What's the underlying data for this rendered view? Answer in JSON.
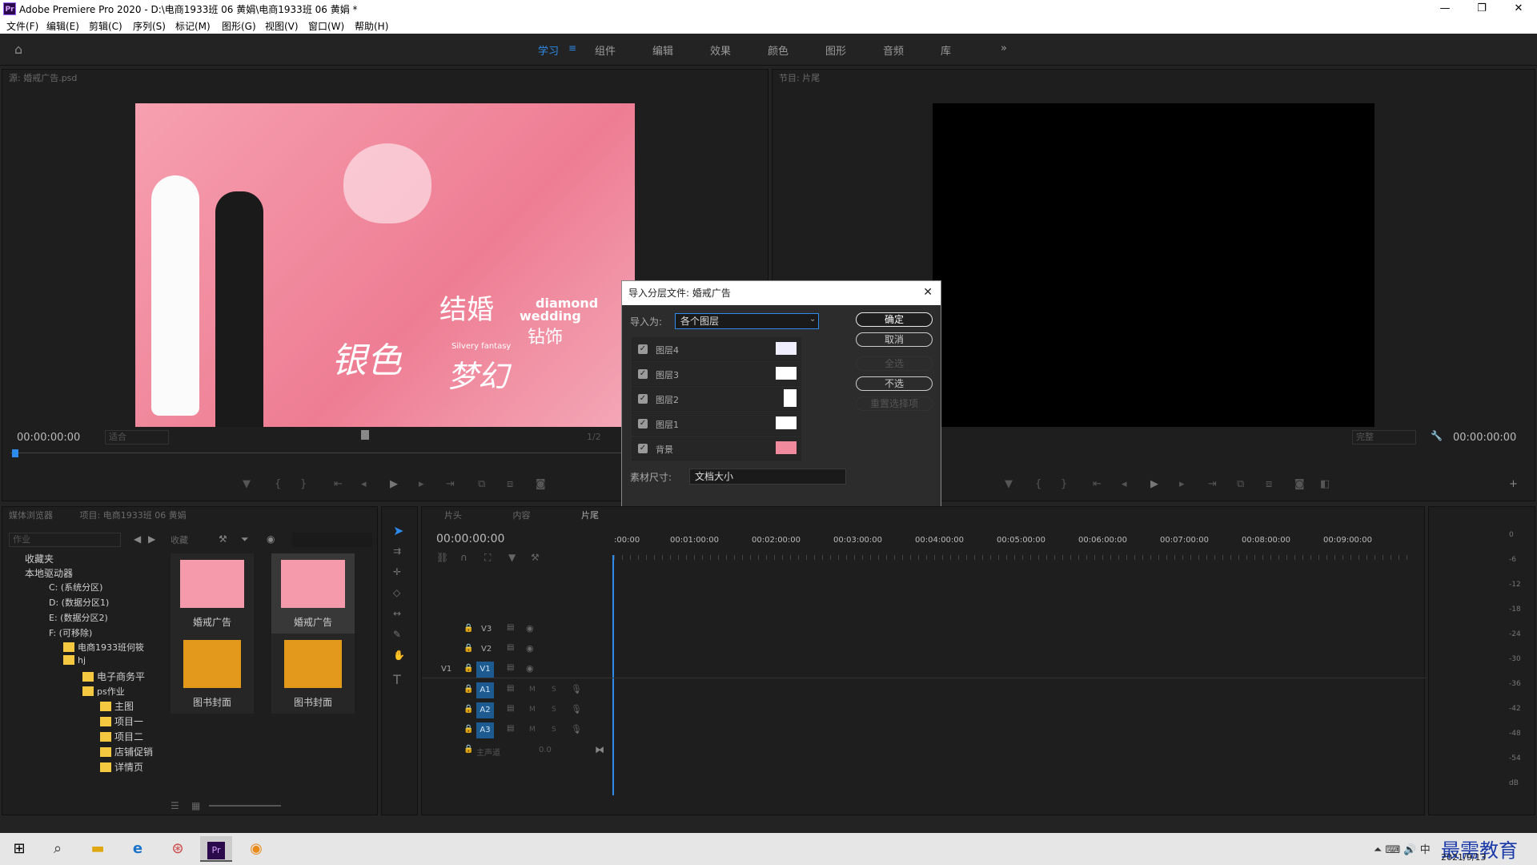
{
  "window": {
    "title": "Adobe Premiere Pro 2020 - D:\\电商1933班 06 黄娟\\电商1933班 06 黄娟 *",
    "logo": "Pr"
  },
  "menu": [
    "文件(F)",
    "编辑(E)",
    "剪辑(C)",
    "序列(S)",
    "标记(M)",
    "图形(G)",
    "视图(V)",
    "窗口(W)",
    "帮助(H)"
  ],
  "workspaces": {
    "items": [
      "学习",
      "组件",
      "编辑",
      "效果",
      "颜色",
      "图形",
      "音频",
      "库"
    ],
    "active": "学习",
    "more": "»"
  },
  "source": {
    "title": "源: 婚戒广告.psd",
    "timecode": "00:00:00:00",
    "fit": "适合",
    "page": "1/2",
    "poster": {
      "t1": "结婚",
      "t2": "diamond",
      "t3": "wedding",
      "t4": "钻饰",
      "t5": "Silvery fantasy",
      "t6": "银色",
      "t7": "梦幻"
    }
  },
  "program": {
    "title": "节目: 片尾",
    "timecode": "00:00:00:00",
    "quality": "完整"
  },
  "dialog": {
    "title": "导入分层文件: 婚戒广告",
    "import_as_label": "导入为:",
    "import_as_value": "各个图层",
    "buttons": {
      "ok": "确定",
      "cancel": "取消",
      "select_all": "全选",
      "select_none": "不选",
      "reset": "重置选择项"
    },
    "layers": [
      {
        "name": "图层4",
        "checked": true
      },
      {
        "name": "图层3",
        "checked": true
      },
      {
        "name": "图层2",
        "checked": true
      },
      {
        "name": "图层1",
        "checked": true
      },
      {
        "name": "背景",
        "checked": true
      }
    ],
    "size_label": "素材尺寸:",
    "size_value": "文档大小"
  },
  "media_browser": {
    "tab1": "媒体浏览器",
    "tab2": "项目: 电商1933班 06 黄娟",
    "filter": "作业",
    "fav_label": "收藏",
    "tree": [
      "收藏夹",
      "本地驱动器",
      "C: (系统分区)",
      "D: (数据分区1)",
      "E: (数据分区2)",
      "F: (可移除)",
      "电商1933班何筱",
      "hj",
      "电子商务平",
      "ps作业",
      "主图",
      "项目一",
      "项目二",
      "店铺促销",
      "详情页"
    ],
    "tiles": [
      {
        "label": "婚戒广告"
      },
      {
        "label": "婚戒广告"
      },
      {
        "label": "图书封面"
      },
      {
        "label": "图书封面"
      }
    ]
  },
  "timeline": {
    "tabs": [
      "片头",
      "内容",
      "片尾"
    ],
    "timecode": "00:00:00:00",
    "ruler": [
      ":00:00",
      "00:01:00:00",
      "00:02:00:00",
      "00:03:00:00",
      "00:04:00:00",
      "00:05:00:00",
      "00:06:00:00",
      "00:07:00:00",
      "00:08:00:00",
      "00:09:00:00"
    ],
    "video_tracks": [
      "V3",
      "V2",
      "V1"
    ],
    "audio_tracks": [
      "A1",
      "A2",
      "A3"
    ],
    "source_patch": "V1",
    "master": "主声道",
    "master_val": "0.0",
    "m": "M",
    "s": "S"
  },
  "meter": {
    "scale": [
      "0",
      "-6",
      "-12",
      "-18",
      "-24",
      "-30",
      "-36",
      "-42",
      "-48",
      "-54",
      "dB"
    ]
  },
  "taskbar": {
    "date": "2021/9/13",
    "watermark": "最需教育",
    "ime": "中"
  },
  "colors": {
    "accent": "#2d8ceb",
    "pink": "#f08a9c",
    "track_blue": "#1c5a8f"
  }
}
